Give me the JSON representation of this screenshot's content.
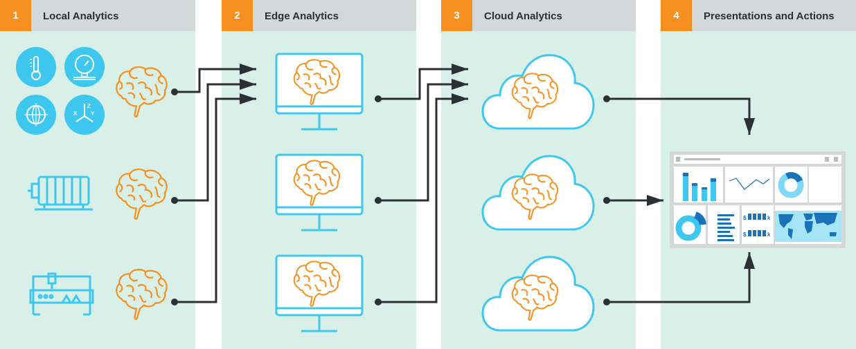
{
  "stages": [
    {
      "number": "1",
      "title": "Local Analytics"
    },
    {
      "number": "2",
      "title": "Edge Analytics"
    },
    {
      "number": "3",
      "title": "Cloud Analytics"
    },
    {
      "number": "4",
      "title": "Presentations and Actions"
    }
  ],
  "sensor_axes": {
    "z": "Z",
    "x": "X",
    "y": "Y"
  },
  "dashboard": {
    "currency_symbol": "$",
    "unit_suffix": "k"
  },
  "colors": {
    "accent": "#f7901e",
    "device_blue": "#3ec8f0",
    "background": "#d9f0e9",
    "header": "#d5d8d9",
    "connector": "#2b2f36"
  }
}
